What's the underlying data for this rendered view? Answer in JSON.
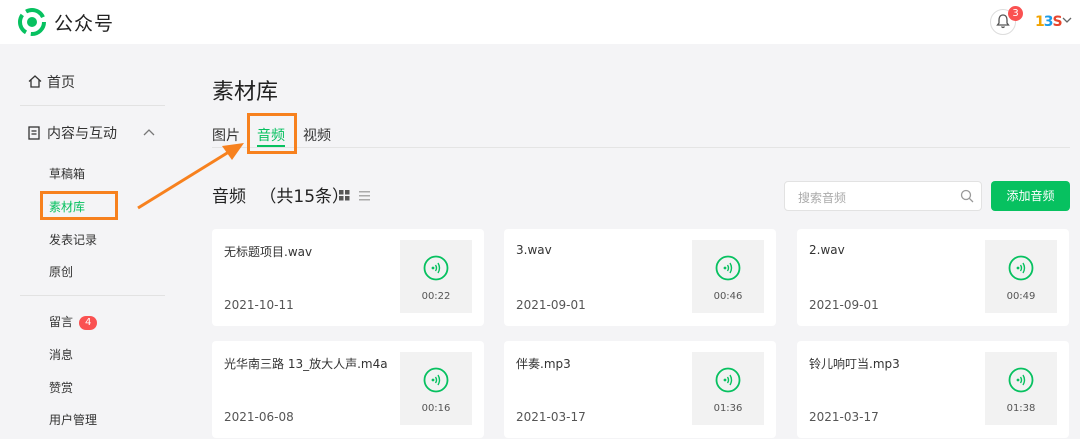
{
  "app": {
    "title": "公众号"
  },
  "header": {
    "notification_count": "3",
    "avatar_text": [
      "1",
      "3",
      "S"
    ]
  },
  "sidebar": {
    "home": "首页",
    "content_group": "内容与互动",
    "items": [
      {
        "label": "草稿箱"
      },
      {
        "label": "素材库"
      },
      {
        "label": "发表记录"
      },
      {
        "label": "原创"
      },
      {
        "label": "留言",
        "badge": "4"
      },
      {
        "label": "消息"
      },
      {
        "label": "赞赏"
      },
      {
        "label": "用户管理"
      }
    ]
  },
  "main": {
    "title": "素材库",
    "tabs": [
      {
        "label": "图片"
      },
      {
        "label": "音频"
      },
      {
        "label": "视频"
      }
    ],
    "section_title": "音频",
    "section_count": "（共15条）",
    "search_placeholder": "搜索音频",
    "add_button": "添加音频",
    "audios": [
      {
        "name": "无标题项目.wav",
        "date": "2021-10-11",
        "duration": "00:22"
      },
      {
        "name": "3.wav",
        "date": "2021-09-01",
        "duration": "00:46"
      },
      {
        "name": "2.wav",
        "date": "2021-09-01",
        "duration": "00:49"
      },
      {
        "name": "光华南三路 13_放大人声.m4a",
        "date": "2021-06-08",
        "duration": "00:16"
      },
      {
        "name": "伴奏.mp3",
        "date": "2021-03-17",
        "duration": "01:36"
      },
      {
        "name": "铃儿响叮当.mp3",
        "date": "2021-03-17",
        "duration": "01:38"
      }
    ]
  },
  "colors": {
    "accent": "#07c160",
    "highlight": "#f7811e",
    "badge": "#fa5151"
  }
}
